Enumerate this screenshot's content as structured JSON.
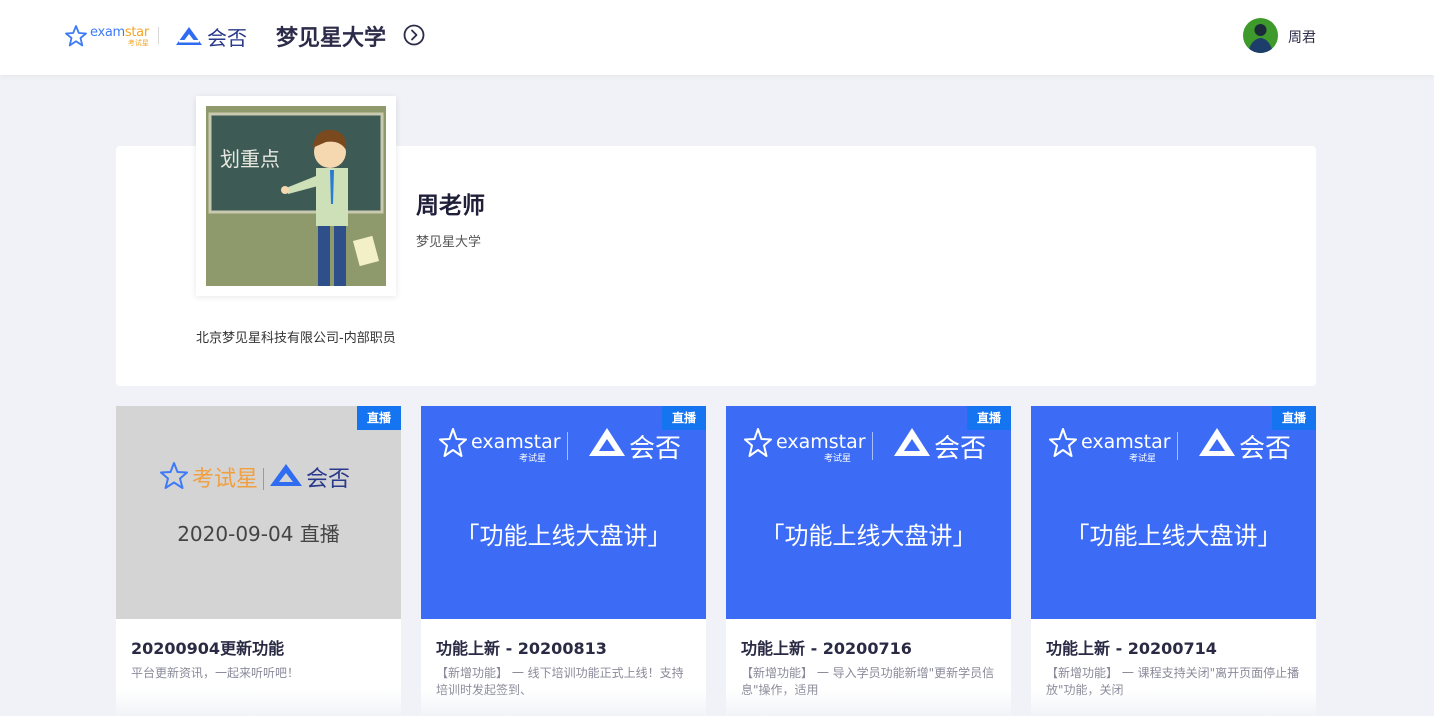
{
  "header": {
    "brand_en_1": "exam",
    "brand_en_2": "star",
    "brand_cn_small": "考试星",
    "partner_brand": "会否",
    "university_title": "梦见星大学",
    "user_name": "周君"
  },
  "profile": {
    "photo_text": "划重点",
    "name": "周老师",
    "org": "梦见星大学",
    "description": "北京梦见星科技有限公司-内部职员"
  },
  "courses": [
    {
      "badge": "直播",
      "thumb_style": "gray",
      "thumb_brand": "考试星",
      "thumb_partner": "会否",
      "thumb_text": "2020-09-04 直播",
      "title": "20200904更新功能",
      "desc": "平台更新资讯，一起来听听吧！"
    },
    {
      "badge": "直播",
      "thumb_style": "blue",
      "thumb_brand_en": "examstar",
      "thumb_brand_cn": "考试星",
      "thumb_partner": "会否",
      "thumb_text": "「功能上线大盘讲」",
      "title": "功能上新 - 20200813",
      "desc": "【新增功能】 一 线下培训功能正式上线！支持培训时发起签到、"
    },
    {
      "badge": "直播",
      "thumb_style": "blue",
      "thumb_brand_en": "examstar",
      "thumb_brand_cn": "考试星",
      "thumb_partner": "会否",
      "thumb_text": "「功能上线大盘讲」",
      "title": "功能上新 - 20200716",
      "desc": "【新增功能】 一 导入学员功能新增\"更新学员信息\"操作，适用"
    },
    {
      "badge": "直播",
      "thumb_style": "blue",
      "thumb_brand_en": "examstar",
      "thumb_brand_cn": "考试星",
      "thumb_partner": "会否",
      "thumb_text": "「功能上线大盘讲」",
      "title": "功能上新 - 20200714",
      "desc": "【新增功能】 一 课程支持关闭\"离开页面停止播放\"功能，关闭"
    }
  ],
  "colors": {
    "accent_blue": "#3c6cf6",
    "badge_blue": "#1574f0",
    "brand_orange": "#f5a623"
  }
}
